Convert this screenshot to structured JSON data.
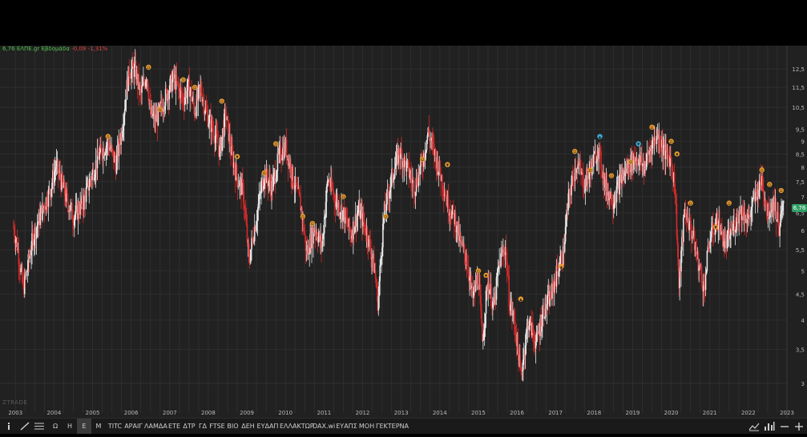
{
  "quote": {
    "price": "6,76",
    "symbol": "ΕΛΠΕ.gr",
    "period": "Εβδομάδα",
    "change": "-0,09 -1,31%"
  },
  "last_price_badge": "6,76",
  "watermark": "ZTRADE",
  "toolbar": {
    "period_buttons": [
      "Ω",
      "Η",
      "Ε",
      "Μ"
    ],
    "active_period": "Ε",
    "symbols": [
      "TITC",
      "ΑΡΑΙΓ",
      "ΛΑΜΔΑ",
      "ΕΤΕ",
      "ΔΤΡ",
      "ΓΔ",
      "FTSE",
      "ΒΙΟ",
      "ΔΕΗ",
      "ΕΥΔΑΠ",
      "ΕΛΛΑΚΤΩΡ",
      "DAX.wi",
      "ΕΥΑΠΣ",
      "ΜΟΗ",
      "ΓΕΚΤΕΡΝΑ"
    ],
    "icons": [
      "info-icon",
      "draw-line-icon",
      "menu-lines-icon",
      "chart-type-icon",
      "indicators-icon",
      "zoom-out-icon",
      "zoom-in-icon"
    ]
  },
  "colors": {
    "background": "#212121",
    "grid": "#2e2e2e",
    "up_candle": "#e8e8e8",
    "down_candle": "#d42a2a",
    "axis_text": "#b8b8b8",
    "badge": "#2f9e64",
    "marker_orange": "#e89a2c",
    "marker_blue": "#3fa9d8"
  },
  "chart_data": {
    "type": "candlestick",
    "title": "",
    "xlabel": "",
    "ylabel": "",
    "x_tick_labels": [
      "2003",
      "2004",
      "2005",
      "2006",
      "2007",
      "2008",
      "2009",
      "2010",
      "2011",
      "2012",
      "2013",
      "2014",
      "2015",
      "2016",
      "2017",
      "2018",
      "2019",
      "2020",
      "2021",
      "2022",
      "2023"
    ],
    "y_tick_labels": [
      "3",
      "3,5",
      "4",
      "4,5",
      "5",
      "5,5",
      "6",
      "6,5",
      "7",
      "7,5",
      "8",
      "8,5",
      "9",
      "9,5",
      "10,5",
      "11,5",
      "12,5"
    ],
    "y_tick_values": [
      3,
      3.5,
      4,
      4.5,
      5,
      5.5,
      6,
      6.5,
      7,
      7.5,
      8,
      8.5,
      9,
      9.5,
      10.5,
      11.5,
      12.5
    ],
    "y_scale": "log",
    "ylim": [
      2.7,
      13.5
    ],
    "xlim": [
      2002.6,
      2023.0
    ],
    "grid": true,
    "price_path": [
      [
        2002.95,
        6.1
      ],
      [
        2003.05,
        5.6
      ],
      [
        2003.2,
        4.6
      ],
      [
        2003.3,
        5.0
      ],
      [
        2003.45,
        5.8
      ],
      [
        2003.7,
        6.6
      ],
      [
        2003.9,
        7.2
      ],
      [
        2004.05,
        8.1
      ],
      [
        2004.3,
        7.0
      ],
      [
        2004.5,
        6.4
      ],
      [
        2004.75,
        6.8
      ],
      [
        2004.95,
        7.6
      ],
      [
        2005.15,
        8.4
      ],
      [
        2005.4,
        9.0
      ],
      [
        2005.6,
        8.1
      ],
      [
        2005.75,
        9.4
      ],
      [
        2005.95,
        12.4
      ],
      [
        2006.1,
        12.5
      ],
      [
        2006.25,
        11.1
      ],
      [
        2006.4,
        12.3
      ],
      [
        2006.5,
        10.2
      ],
      [
        2006.65,
        9.9
      ],
      [
        2006.8,
        10.6
      ],
      [
        2006.95,
        11.3
      ],
      [
        2007.1,
        12.0
      ],
      [
        2007.35,
        10.9
      ],
      [
        2007.5,
        11.6
      ],
      [
        2007.65,
        10.3
      ],
      [
        2007.8,
        11.5
      ],
      [
        2007.95,
        10.2
      ],
      [
        2008.15,
        9.4
      ],
      [
        2008.3,
        8.6
      ],
      [
        2008.45,
        10.2
      ],
      [
        2008.6,
        8.5
      ],
      [
        2008.75,
        7.6
      ],
      [
        2008.9,
        7.2
      ],
      [
        2009.05,
        5.2
      ],
      [
        2009.25,
        6.4
      ],
      [
        2009.45,
        7.8
      ],
      [
        2009.65,
        7.3
      ],
      [
        2009.85,
        8.5
      ],
      [
        2010.0,
        8.8
      ],
      [
        2010.2,
        7.6
      ],
      [
        2010.4,
        6.7
      ],
      [
        2010.55,
        5.4
      ],
      [
        2010.75,
        6.1
      ],
      [
        2010.95,
        5.6
      ],
      [
        2011.1,
        7.6
      ],
      [
        2011.3,
        6.9
      ],
      [
        2011.5,
        6.5
      ],
      [
        2011.7,
        5.9
      ],
      [
        2011.9,
        6.6
      ],
      [
        2012.1,
        6.0
      ],
      [
        2012.3,
        5.1
      ],
      [
        2012.4,
        4.3
      ],
      [
        2012.55,
        6.4
      ],
      [
        2012.75,
        7.6
      ],
      [
        2012.95,
        8.6
      ],
      [
        2013.15,
        8.0
      ],
      [
        2013.35,
        7.3
      ],
      [
        2013.55,
        8.2
      ],
      [
        2013.7,
        9.4
      ],
      [
        2013.85,
        8.6
      ],
      [
        2014.05,
        7.6
      ],
      [
        2014.2,
        6.8
      ],
      [
        2014.4,
        6.3
      ],
      [
        2014.55,
        5.6
      ],
      [
        2014.7,
        5.3
      ],
      [
        2014.85,
        4.4
      ],
      [
        2015.0,
        4.9
      ],
      [
        2015.1,
        3.6
      ],
      [
        2015.25,
        4.8
      ],
      [
        2015.4,
        4.2
      ],
      [
        2015.55,
        5.2
      ],
      [
        2015.7,
        5.6
      ],
      [
        2015.8,
        4.4
      ],
      [
        2015.95,
        3.9
      ],
      [
        2016.1,
        3.1
      ],
      [
        2016.3,
        4.0
      ],
      [
        2016.5,
        3.6
      ],
      [
        2016.7,
        4.2
      ],
      [
        2016.9,
        4.5
      ],
      [
        2017.05,
        5.0
      ],
      [
        2017.2,
        5.4
      ],
      [
        2017.35,
        7.0
      ],
      [
        2017.55,
        8.2
      ],
      [
        2017.75,
        7.4
      ],
      [
        2017.95,
        8.1
      ],
      [
        2018.1,
        8.7
      ],
      [
        2018.3,
        7.3
      ],
      [
        2018.5,
        6.9
      ],
      [
        2018.7,
        7.6
      ],
      [
        2018.9,
        8.1
      ],
      [
        2019.1,
        8.4
      ],
      [
        2019.3,
        8.0
      ],
      [
        2019.5,
        8.9
      ],
      [
        2019.65,
        9.3
      ],
      [
        2019.85,
        8.5
      ],
      [
        2020.0,
        8.3
      ],
      [
        2020.1,
        7.2
      ],
      [
        2020.2,
        4.6
      ],
      [
        2020.35,
        6.6
      ],
      [
        2020.55,
        5.9
      ],
      [
        2020.7,
        5.2
      ],
      [
        2020.85,
        4.6
      ],
      [
        2021.0,
        5.8
      ],
      [
        2021.2,
        6.3
      ],
      [
        2021.4,
        5.6
      ],
      [
        2021.6,
        6.1
      ],
      [
        2021.8,
        6.6
      ],
      [
        2022.0,
        6.3
      ],
      [
        2022.2,
        7.1
      ],
      [
        2022.35,
        7.6
      ],
      [
        2022.5,
        6.5
      ],
      [
        2022.65,
        6.9
      ],
      [
        2022.8,
        6.1
      ],
      [
        2022.92,
        6.76
      ]
    ],
    "markers": [
      {
        "x": 2005.4,
        "y": 9.2,
        "label": "Ω",
        "color": "orange"
      },
      {
        "x": 2006.45,
        "y": 12.6,
        "label": "Ω",
        "color": "orange"
      },
      {
        "x": 2006.75,
        "y": 10.4,
        "label": "Ω",
        "color": "orange"
      },
      {
        "x": 2007.35,
        "y": 11.9,
        "label": "Ω",
        "color": "orange"
      },
      {
        "x": 2007.65,
        "y": 11.5,
        "label": "Ω",
        "color": "orange"
      },
      {
        "x": 2008.35,
        "y": 10.8,
        "label": "Ω",
        "color": "orange"
      },
      {
        "x": 2008.75,
        "y": 8.4,
        "label": "▼",
        "color": "orange"
      },
      {
        "x": 2009.45,
        "y": 7.8,
        "label": "Ω",
        "color": "orange"
      },
      {
        "x": 2009.75,
        "y": 8.9,
        "label": "Ω",
        "color": "orange"
      },
      {
        "x": 2010.45,
        "y": 6.4,
        "label": "Ω",
        "color": "orange"
      },
      {
        "x": 2010.7,
        "y": 6.2,
        "label": "Ω",
        "color": "orange"
      },
      {
        "x": 2011.5,
        "y": 7.0,
        "label": "Ω",
        "color": "orange"
      },
      {
        "x": 2012.6,
        "y": 6.4,
        "label": "Ω",
        "color": "orange"
      },
      {
        "x": 2013.55,
        "y": 8.3,
        "label": "Ω",
        "color": "orange"
      },
      {
        "x": 2014.2,
        "y": 8.1,
        "label": "▼",
        "color": "orange"
      },
      {
        "x": 2015.0,
        "y": 5.0,
        "label": "Ω",
        "color": "orange"
      },
      {
        "x": 2015.2,
        "y": 4.9,
        "label": "▼",
        "color": "orange"
      },
      {
        "x": 2016.1,
        "y": 4.4,
        "label": "▲",
        "color": "orange"
      },
      {
        "x": 2017.15,
        "y": 5.1,
        "label": "▲",
        "color": "orange"
      },
      {
        "x": 2017.5,
        "y": 8.6,
        "label": "Ω",
        "color": "orange"
      },
      {
        "x": 2017.9,
        "y": 7.9,
        "label": "Ω",
        "color": "orange"
      },
      {
        "x": 2018.15,
        "y": 9.2,
        "label": "▲",
        "color": "blue"
      },
      {
        "x": 2018.45,
        "y": 7.7,
        "label": "Ω",
        "color": "orange"
      },
      {
        "x": 2018.95,
        "y": 8.2,
        "label": "Ω",
        "color": "orange"
      },
      {
        "x": 2019.15,
        "y": 8.9,
        "label": "▼",
        "color": "blue"
      },
      {
        "x": 2019.5,
        "y": 9.6,
        "label": "Ω",
        "color": "orange"
      },
      {
        "x": 2020.0,
        "y": 9.0,
        "label": "Ω",
        "color": "orange"
      },
      {
        "x": 2020.15,
        "y": 8.5,
        "label": "▼",
        "color": "orange"
      },
      {
        "x": 2020.5,
        "y": 6.8,
        "label": "Ω",
        "color": "orange"
      },
      {
        "x": 2021.15,
        "y": 6.1,
        "label": "▼",
        "color": "orange"
      },
      {
        "x": 2021.5,
        "y": 6.8,
        "label": "Ω",
        "color": "orange"
      },
      {
        "x": 2022.35,
        "y": 7.9,
        "label": "Ω",
        "color": "orange"
      },
      {
        "x": 2022.55,
        "y": 7.4,
        "label": "Ω",
        "color": "orange"
      },
      {
        "x": 2022.85,
        "y": 7.2,
        "label": "Ω",
        "color": "orange"
      }
    ]
  }
}
